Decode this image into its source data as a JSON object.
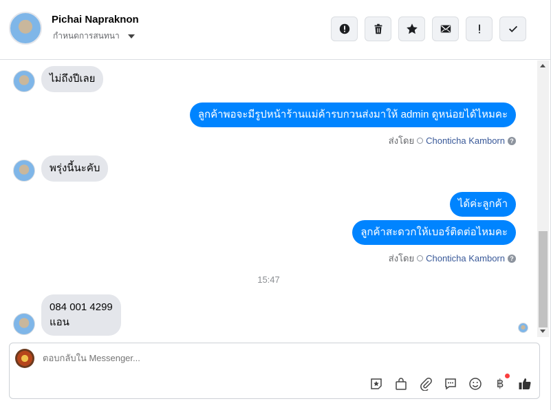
{
  "header": {
    "name": "Pichai Napraknon",
    "subtitle": "กำหนดการสนทนา",
    "actions": [
      {
        "name": "report",
        "icon": "alert-circle-icon"
      },
      {
        "name": "delete",
        "icon": "trash-icon"
      },
      {
        "name": "star",
        "icon": "star-icon"
      },
      {
        "name": "mark-unread",
        "icon": "envelope-icon"
      },
      {
        "name": "important",
        "icon": "exclamation-icon"
      },
      {
        "name": "done",
        "icon": "checkmark-icon"
      }
    ]
  },
  "messages": [
    {
      "direction": "in",
      "text": "ไม่ถึงปีเลย"
    },
    {
      "direction": "out",
      "text": "ลูกค้าพอจะมีรูปหน้าร้านแม่ค้ารบกวนส่งมาให้ admin ดูหน่อยได้ไหมคะ"
    },
    {
      "direction": "in",
      "text": "พรุ่งนี้นะคับ"
    },
    {
      "direction": "out",
      "text": "ได้ค่ะลูกค้า"
    },
    {
      "direction": "out",
      "text": "ลูกค้าสะดวกให้เบอร์ติดต่อไหมคะ"
    },
    {
      "direction": "in",
      "lines": [
        "084 001 4299",
        "แอน"
      ]
    }
  ],
  "sent_by": {
    "prefix": "ส่งโดย",
    "name": "Chonticha Kamborn",
    "help": "?"
  },
  "timestamp": "15:47",
  "composer": {
    "placeholder": "ตอบกลับใน Messenger...",
    "tools": [
      "sticker-icon",
      "shopping-bag-icon",
      "paperclip-icon",
      "chat-bubble-icon",
      "smiley-icon",
      "baht-icon",
      "thumbs-up-icon"
    ],
    "baht_symbol": "฿"
  }
}
